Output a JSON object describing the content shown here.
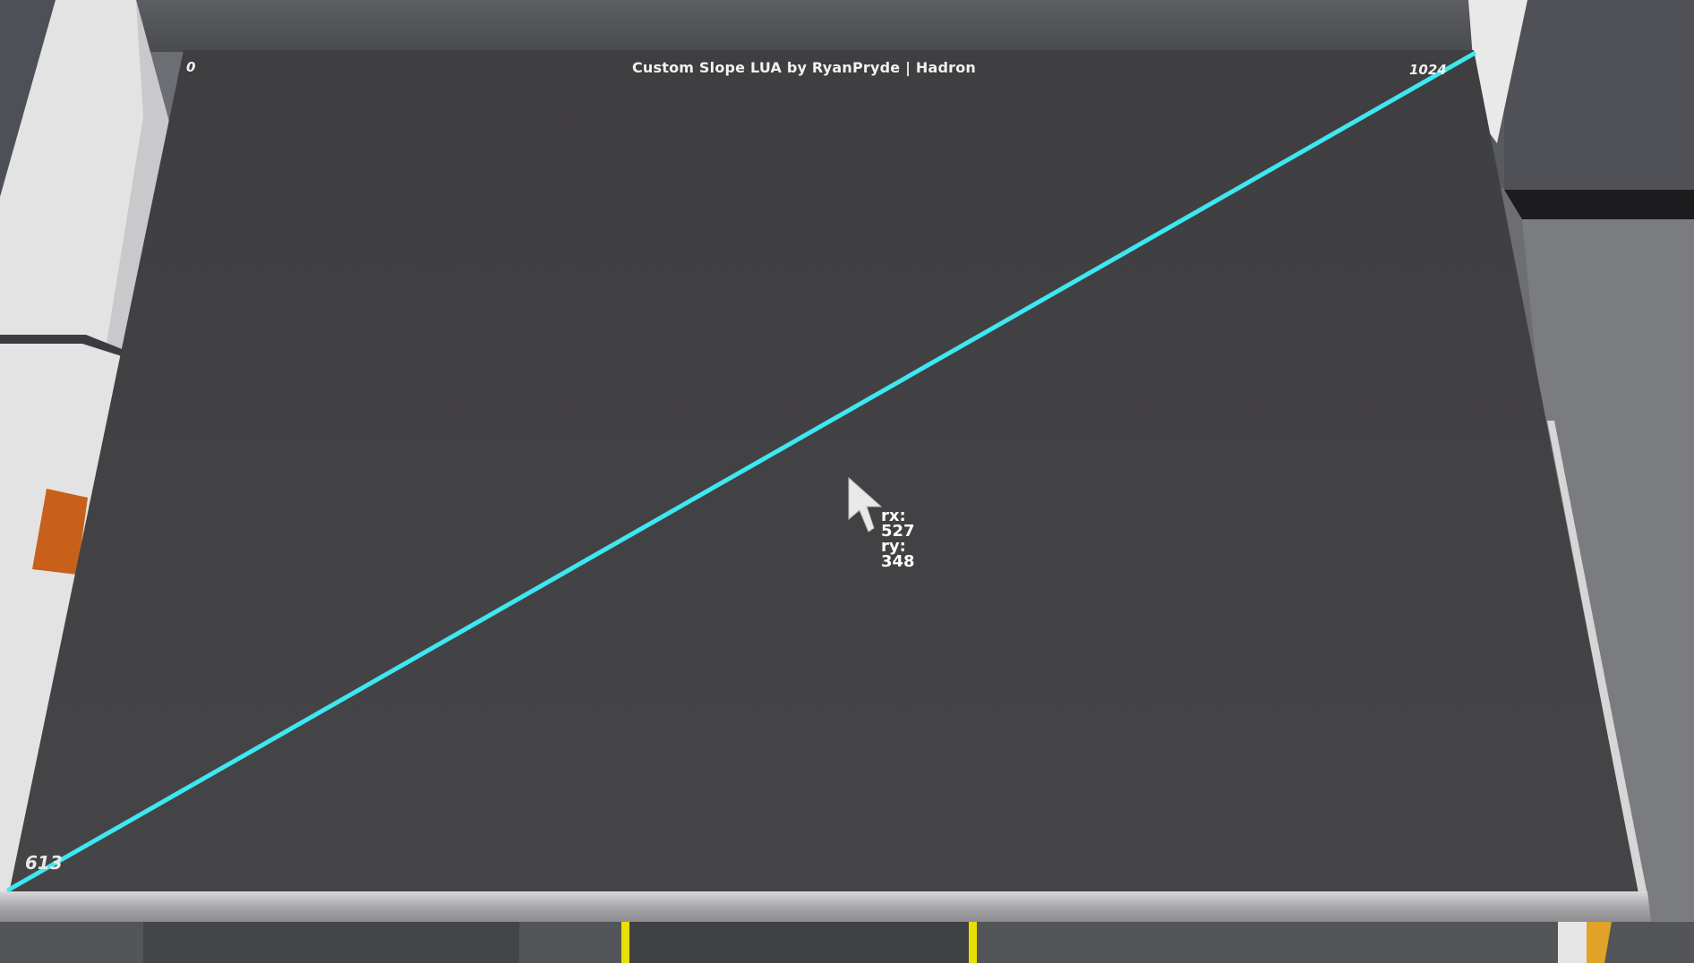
{
  "screen": {
    "title": "Custom Slope LUA by RyanPryde | Hadron",
    "corner_labels": {
      "top_left": "0",
      "top_right": "1024",
      "bottom_left": "613"
    }
  },
  "cursor": {
    "rx_label": "rx: 527",
    "ry_label": "ry: 348"
  },
  "colors": {
    "slope_line": "#3ee8f0",
    "screen_bg": "#444346",
    "frame_steel": "#b9b9bb",
    "accent_orange": "#c85f14",
    "marker_yellow": "#e8e000"
  }
}
